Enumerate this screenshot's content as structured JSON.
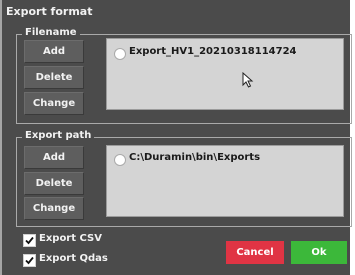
{
  "dialog": {
    "title": "Export format"
  },
  "filename_group": {
    "label": "Filename",
    "buttons": {
      "add": "Add",
      "delete": "Delete",
      "change": "Change"
    },
    "entries": [
      "Export_HV1_20210318114724"
    ]
  },
  "path_group": {
    "label": "Export path",
    "buttons": {
      "add": "Add",
      "delete": "Delete",
      "change": "Change"
    },
    "entries": [
      "C:\\Duramin\\bin\\Exports"
    ]
  },
  "options": {
    "export_csv": {
      "label": "Export CSV",
      "checked": true
    },
    "export_qdas": {
      "label": "Export Qdas",
      "checked": true
    }
  },
  "actions": {
    "cancel": "Cancel",
    "ok": "Ok"
  },
  "colors": {
    "panel": "#4b4b4b",
    "cancel": "#e03444",
    "ok": "#3cb83a"
  }
}
